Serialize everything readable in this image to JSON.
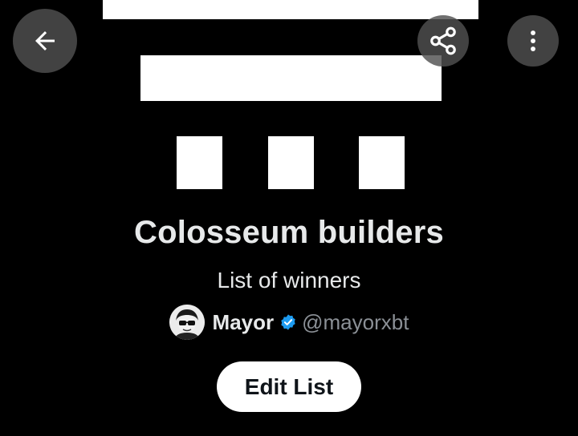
{
  "header": {
    "back_icon": "arrow-left-icon",
    "share_icon": "share-icon",
    "more_icon": "more-vertical-icon"
  },
  "list": {
    "title": "Colosseum builders",
    "description": "List of winners"
  },
  "owner": {
    "name": "Mayor",
    "handle": "@mayorxbt",
    "verified_icon": "verified-badge-icon",
    "verified_color": "#1d9bf0"
  },
  "actions": {
    "edit_label": "Edit List"
  },
  "colors": {
    "background": "#000000",
    "text_primary": "#e7e9ea",
    "text_secondary": "#8b9096",
    "button_bg": "#ffffff",
    "button_text": "#0f1419"
  }
}
